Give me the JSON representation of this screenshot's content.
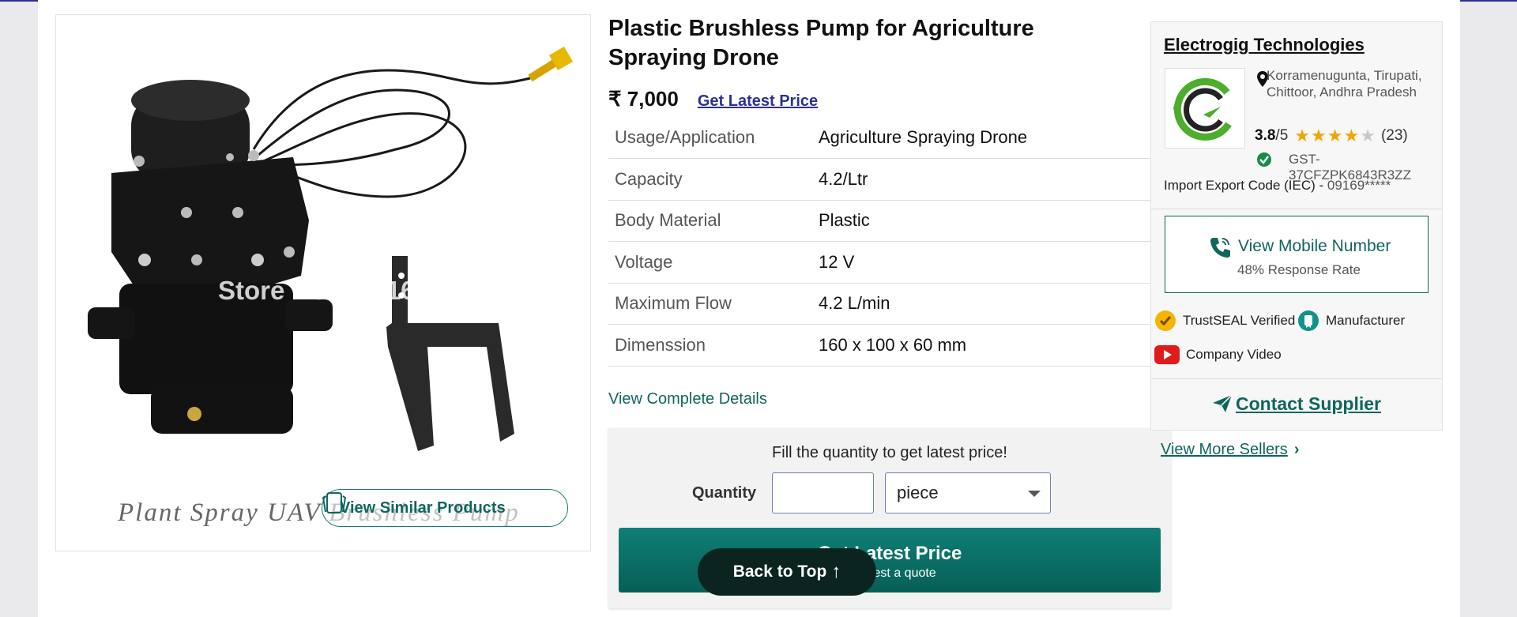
{
  "product": {
    "title": "Plastic Brushless Pump for Agriculture Spraying Drone",
    "price": "₹ 7,000",
    "price_link": "Get Latest Price",
    "image_watermark": "Store No: 512161",
    "image_caption": "Plant Spray UAV Brushless Pump",
    "view_similar": "View Similar Products",
    "specs": [
      {
        "key": "Usage/Application",
        "value": "Agriculture Spraying Drone"
      },
      {
        "key": "Capacity",
        "value": "4.2/Ltr"
      },
      {
        "key": "Body Material",
        "value": "Plastic"
      },
      {
        "key": "Voltage",
        "value": "12 V"
      },
      {
        "key": "Maximum Flow",
        "value": "4.2 L/min"
      },
      {
        "key": "Dimenssion",
        "value": "160 x 100 x 60 mm"
      }
    ],
    "view_details": "View Complete Details"
  },
  "quote": {
    "prompt": "Fill the quantity to get latest price!",
    "quantity_label": "Quantity",
    "quantity_value": "",
    "unit": "piece",
    "cta_main": "Get Latest Price",
    "cta_sub": "Request a quote"
  },
  "back_to_top": "Back to Top",
  "seller": {
    "name": "Electrogig Technologies",
    "location": "Korramenugunta, Tirupati, Chittoor, Andhra Pradesh",
    "rating": "3.8",
    "rating_max": "/5",
    "rating_stars": 3.8,
    "review_count": "(23)",
    "gst": "GST- 37CFZPK6843R3ZZ",
    "iec_label": "Import Export Code (IEC) - ",
    "iec_value": "09169*****",
    "mobile_label": "View Mobile Number",
    "response_rate": "48% Response Rate",
    "badges": [
      "TrustSEAL Verified",
      "Manufacturer",
      "Company Video"
    ],
    "contact": "Contact Supplier"
  },
  "more_sellers": "View More Sellers",
  "colors": {
    "accent": "#10665c",
    "link": "#2e3192",
    "star": "#f0a500"
  }
}
